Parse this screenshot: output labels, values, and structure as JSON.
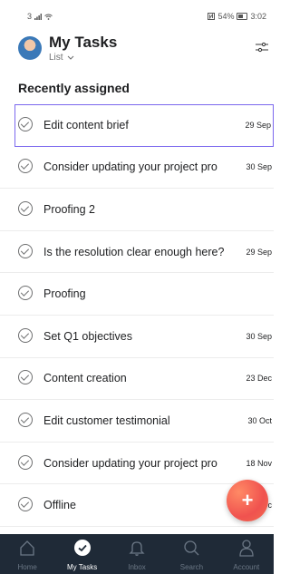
{
  "status_bar": {
    "left_text": "3",
    "right_text": "54%",
    "time": "3:02"
  },
  "header": {
    "title": "My Tasks",
    "view_label": "List"
  },
  "section": {
    "title": "Recently assigned"
  },
  "tasks": [
    {
      "name": "Edit content brief",
      "date": "29 Sep",
      "selected": true
    },
    {
      "name": "Consider updating your project pro",
      "date": "30 Sep",
      "selected": false
    },
    {
      "name": "Proofing 2",
      "date": "",
      "selected": false
    },
    {
      "name": "Is the resolution clear enough here?",
      "date": "29 Sep",
      "selected": false
    },
    {
      "name": "Proofing",
      "date": "",
      "selected": false
    },
    {
      "name": "Set Q1 objectives",
      "date": "30 Sep",
      "selected": false
    },
    {
      "name": "Content creation",
      "date": "23 Dec",
      "selected": false
    },
    {
      "name": "Edit customer testimonial",
      "date": "30 Oct",
      "selected": false
    },
    {
      "name": "Consider updating your project pro",
      "date": "18 Nov",
      "selected": false
    },
    {
      "name": "Offline",
      "date": "c",
      "selected": false
    }
  ],
  "fab": {
    "label": "+"
  },
  "bottom_nav": [
    {
      "label": "Home",
      "icon": "home-icon",
      "active": false
    },
    {
      "label": "My Tasks",
      "icon": "check-circle-icon",
      "active": true
    },
    {
      "label": "Inbox",
      "icon": "bell-icon",
      "active": false
    },
    {
      "label": "Search",
      "icon": "search-icon",
      "active": false
    },
    {
      "label": "Account",
      "icon": "user-icon",
      "active": false
    }
  ],
  "colors": {
    "accent": "#7b68ee",
    "fab": "#f0524f",
    "nav_bg": "#1f2a37"
  }
}
